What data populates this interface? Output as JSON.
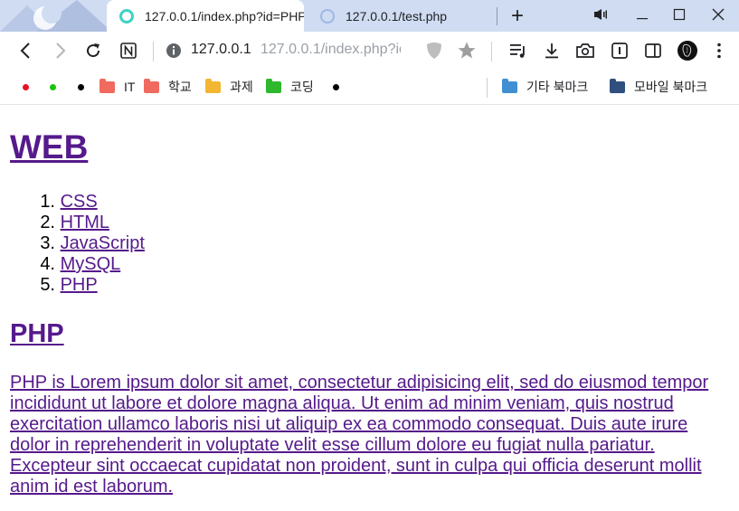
{
  "tabs": [
    {
      "title": "127.0.0.1/index.php?id=PHP",
      "active": true
    },
    {
      "title": "127.0.0.1/test.php",
      "active": false
    }
  ],
  "address_bar": {
    "host": "127.0.0.1",
    "url": "127.0.0.1/index.php?id=PHP"
  },
  "bookmarks": {
    "dot_colors": [
      "#e81123",
      "#16c60c",
      "#000000"
    ],
    "folders": [
      {
        "label": "IT",
        "color": "#f06a5f"
      },
      {
        "label": "학교",
        "color": "#f06a5f"
      },
      {
        "label": "과제",
        "color": "#f2b632"
      },
      {
        "label": "코딩",
        "color": "#2db82d"
      }
    ],
    "other": {
      "label": "기타 북마크",
      "color": "#3f8fd2"
    },
    "mobile": {
      "label": "모바일 북마크",
      "color": "#2f4f7f"
    }
  },
  "page": {
    "heading": "WEB",
    "list": [
      {
        "num": "1.",
        "label": "CSS"
      },
      {
        "num": "2.",
        "label": "HTML"
      },
      {
        "num": "3.",
        "label": "JavaScript"
      },
      {
        "num": "4.",
        "label": "MySQL"
      },
      {
        "num": "5.",
        "label": "PHP"
      }
    ],
    "subheading": "PHP",
    "body": "PHP is Lorem ipsum dolor sit amet, consectetur adipisicing elit, sed do eiusmod tempor incididunt ut labore et dolore magna aliqua. Ut enim ad minim veniam, quis nostrud exercitation ullamco laboris nisi ut aliquip ex ea commodo consequat. Duis aute irure dolor in reprehenderit in voluptate velit esse cillum dolore eu fugiat nulla pariatur. Excepteur sint occaecat cupidatat non proident, sunt in culpa qui officia deserunt mollit anim id est laborum.",
    "link_color": "#551a8b"
  }
}
